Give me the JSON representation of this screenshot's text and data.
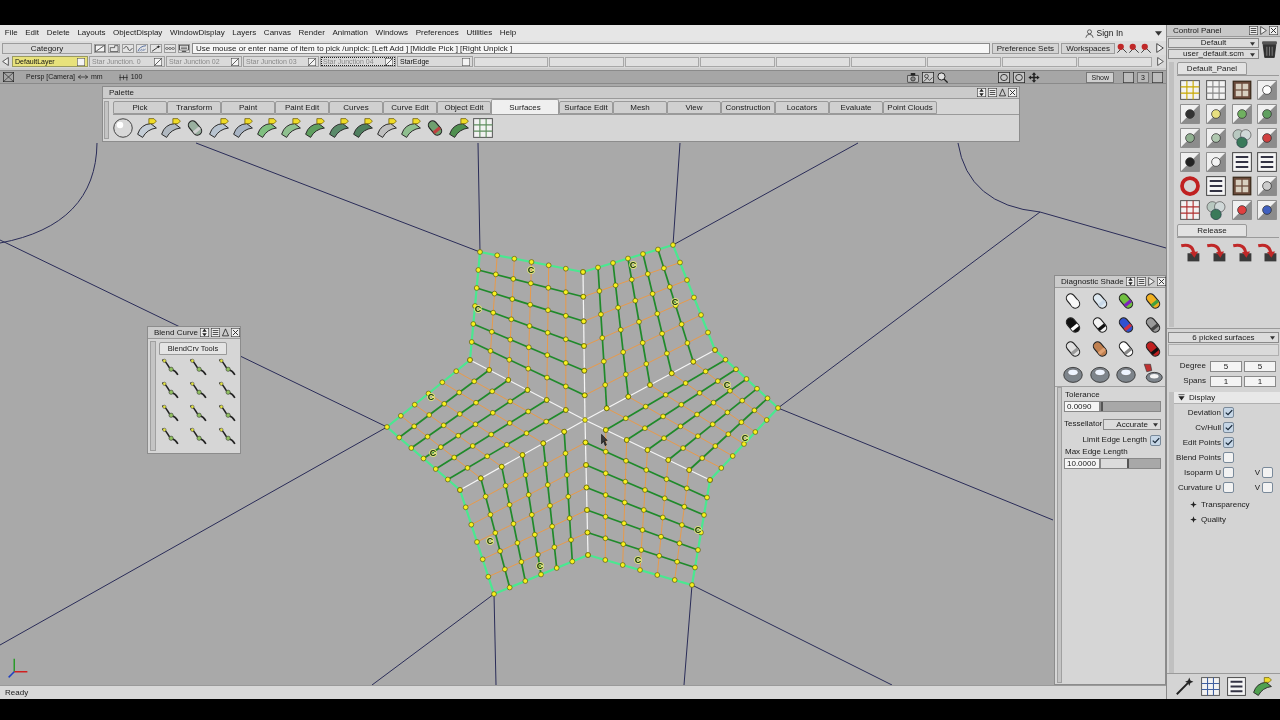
{
  "menu_bar": {
    "items": [
      "File",
      "Edit",
      "Delete",
      "Layouts",
      "ObjectDisplay",
      "WindowDisplay",
      "Layers",
      "Canvas",
      "Render",
      "Animation",
      "Windows",
      "Preferences",
      "Utilities",
      "Help"
    ],
    "sign_in": "Sign In"
  },
  "toolbar": {
    "category": "Category",
    "prompt": "Use mouse or enter name of item to pick /unpick: [Left Add ] [Middle Pick ] [Right Unpick ]",
    "buttons": [
      "Preference Sets",
      "Workspaces"
    ]
  },
  "layers": [
    {
      "label": "DefaultLayer",
      "selected": true,
      "visible": true,
      "focused": false
    },
    {
      "label": "Star Junction. 0",
      "selected": false,
      "visible": false,
      "focused": false
    },
    {
      "label": "Star Junction 02",
      "selected": false,
      "visible": false,
      "focused": false
    },
    {
      "label": "Star Junction 03",
      "selected": false,
      "visible": false,
      "focused": false
    },
    {
      "label": "Star Junction 04",
      "selected": false,
      "visible": false,
      "focused": true
    },
    {
      "label": "StarEdge",
      "selected": false,
      "visible": true,
      "focused": false
    }
  ],
  "viewport": {
    "camera": "Persp [Camera]",
    "units": "mm",
    "scale": "100",
    "show_button": "Show",
    "layout_button": "3",
    "curve_labels": [
      "C",
      "C",
      "C",
      "C",
      "C",
      "C",
      "C",
      "C",
      "C",
      "C",
      "C",
      "C"
    ]
  },
  "palette": {
    "title": "Palette",
    "tabs": [
      {
        "label": "Pick",
        "selected": false
      },
      {
        "label": "Transform",
        "selected": false
      },
      {
        "label": "Paint",
        "selected": false
      },
      {
        "label": "Paint Edit",
        "selected": false
      },
      {
        "label": "Curves",
        "selected": false
      },
      {
        "label": "Curve Edit",
        "selected": false
      },
      {
        "label": "Object Edit",
        "selected": false
      },
      {
        "label": "Surfaces",
        "selected": true
      },
      {
        "label": "Surface Edit",
        "selected": false
      },
      {
        "label": "Mesh",
        "selected": false
      },
      {
        "label": "View",
        "selected": false
      },
      {
        "label": "Construction",
        "selected": false
      },
      {
        "label": "Locators",
        "selected": false
      },
      {
        "label": "Evaluate",
        "selected": false
      },
      {
        "label": "Point Clouds",
        "selected": false
      }
    ]
  },
  "blend_curve": {
    "title": "Blend Curve",
    "tab": "BlendCrv Tools"
  },
  "diagnostic_shade": {
    "title": "Diagnostic Shade",
    "tolerance": {
      "label": "Tolerance",
      "value": "0.0090",
      "level": 0.03
    },
    "tessellator": {
      "label": "Tessellator",
      "value": "Accurate"
    },
    "limit_edge_length": {
      "label": "Limit Edge Length",
      "checked": true
    },
    "max_edge_length": {
      "label": "Max Edge Length",
      "value": "10.0000",
      "level": 0.48
    }
  },
  "control_panel": {
    "title": "Control Panel",
    "preset": "Default",
    "file": "user_default.scm",
    "shelves": [
      "Default_Panel",
      "Release"
    ],
    "selection": "6 picked surfaces",
    "degree": {
      "label": "Degree",
      "u": "5",
      "v": "5"
    },
    "spans": {
      "label": "Spans",
      "u": "1",
      "v": "1"
    },
    "sections": [
      {
        "label": "Display",
        "expanded": true,
        "options": [
          {
            "label": "Deviation",
            "checked": true
          },
          {
            "label": "Cv/Hull",
            "checked": true
          },
          {
            "label": "Edit Points",
            "checked": true
          },
          {
            "label": "Blend Points",
            "checked": false
          },
          {
            "label": "Isoparm U",
            "checked": false,
            "v_label": "V",
            "v_checked": false
          },
          {
            "label": "Curvature U",
            "checked": false,
            "v_label": "V",
            "v_checked": false
          }
        ]
      },
      {
        "label": "Transparency",
        "expanded": false
      },
      {
        "label": "Quality",
        "expanded": false
      }
    ]
  },
  "status_bar": {
    "text": "Ready"
  }
}
